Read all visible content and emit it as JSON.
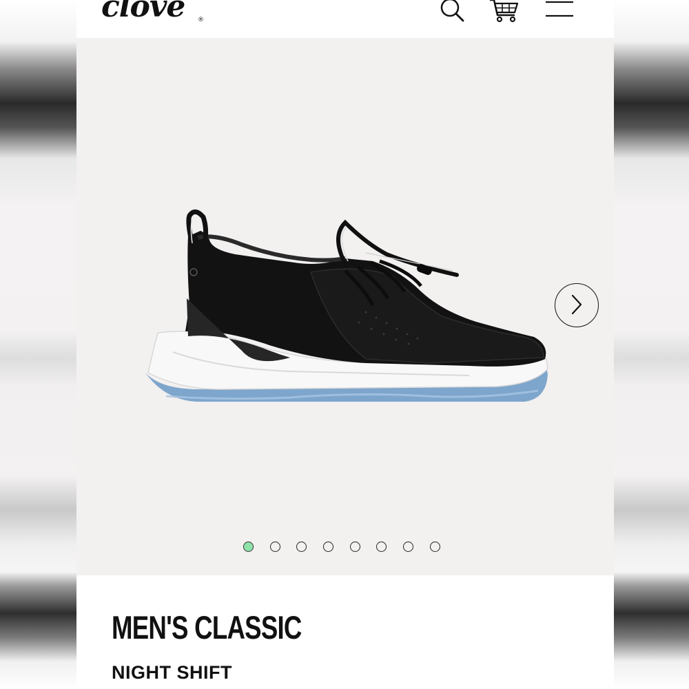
{
  "brand": {
    "logo_text": "clove",
    "registered_mark": "®"
  },
  "header": {
    "icons": [
      "search-icon",
      "cart-icon",
      "hamburger-menu-icon"
    ]
  },
  "gallery": {
    "image_subject": "black sneaker with white midsole and translucent blue outsole",
    "next_icon": "chevron-right-icon",
    "slide_count": 8,
    "active_slide": 1,
    "active_dot_color": "#8fe3a9"
  },
  "product": {
    "name": "MEN'S CLASSIC",
    "colorway": "NIGHT SHIFT"
  },
  "colors": {
    "gallery_bg": "#f3f0f0",
    "text": "#111111"
  }
}
